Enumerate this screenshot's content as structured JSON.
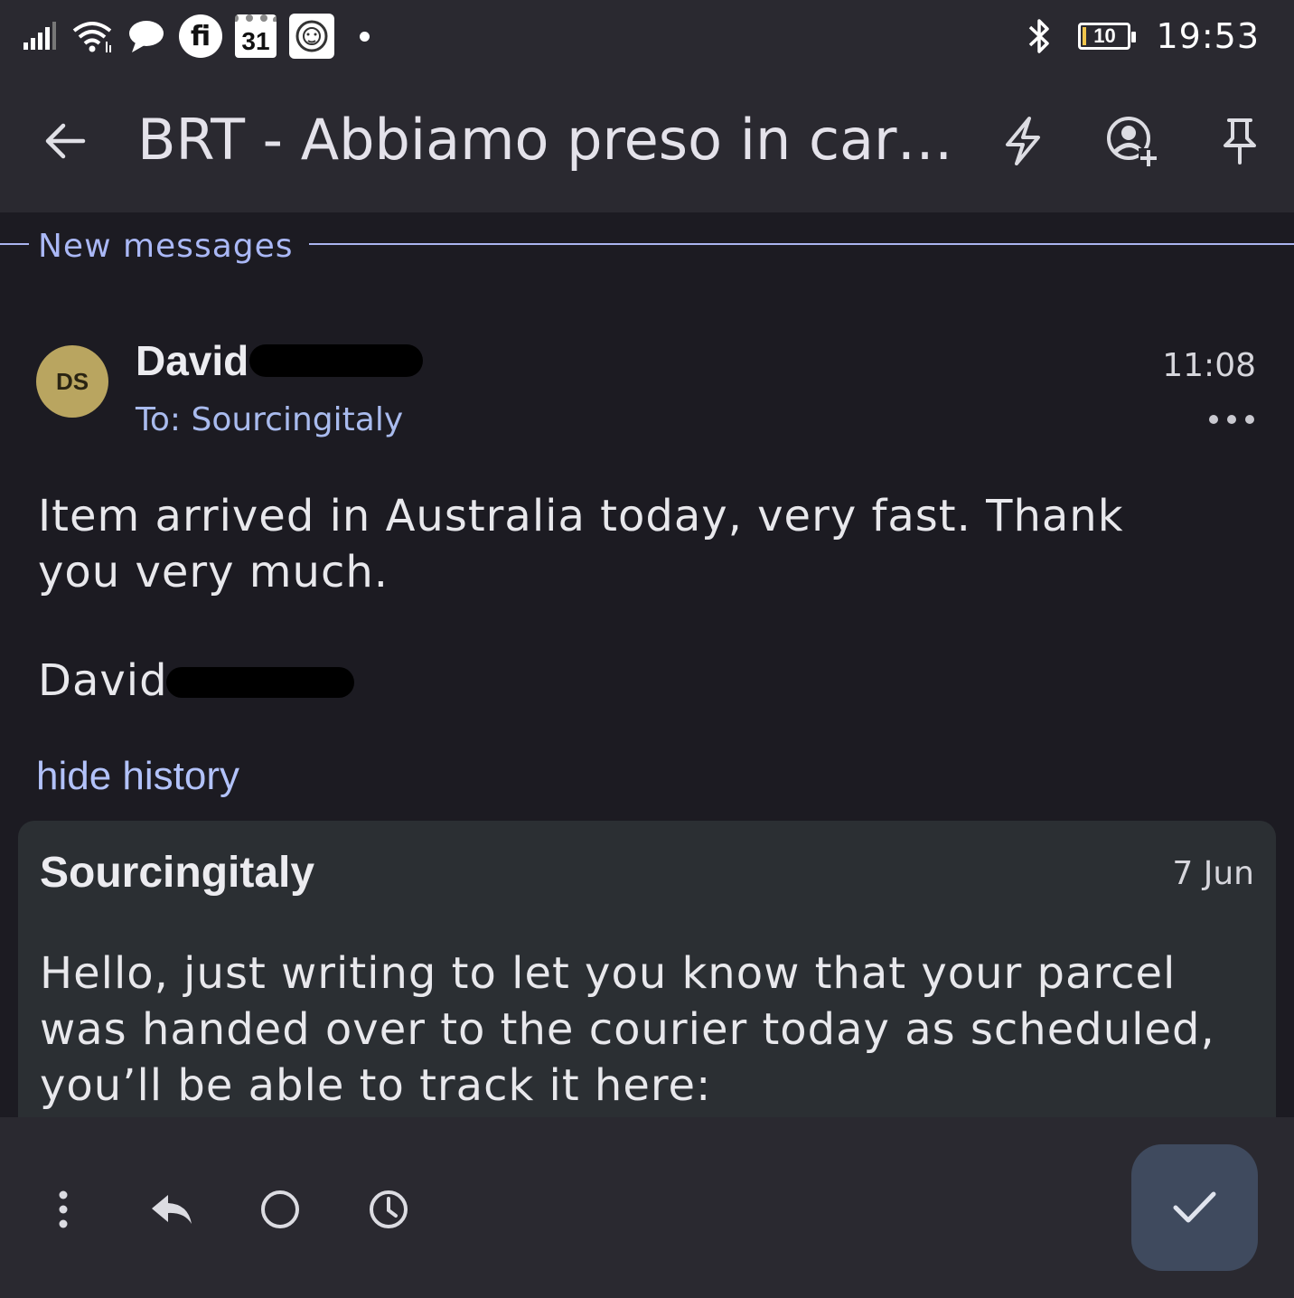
{
  "status_bar": {
    "icons_left": [
      "signal-icon",
      "wifi-icon",
      "chat-bubble-icon",
      "fi-app-icon",
      "calendar-icon",
      "lion-app-icon",
      "notification-dot"
    ],
    "fi_label": "fi",
    "calendar_day": "31",
    "battery": "10",
    "clock": "19:53"
  },
  "app_bar": {
    "title": "BRT - Abbiamo preso in car…",
    "actions": [
      "lightning-icon",
      "add-contact-icon",
      "pin-icon"
    ]
  },
  "divider": {
    "label": "New messages"
  },
  "message": {
    "avatar_initials": "DS",
    "sender": "David",
    "to": "To: Sourcingitaly",
    "time": "11:08",
    "body_lines": [
      "Item arrived in Australia today, very fast.  Thank",
      "you very much."
    ],
    "signature": "David"
  },
  "hide_history_label": "hide history",
  "history": {
    "sender": "Sourcingitaly",
    "date": "7 Jun",
    "body_lines": [
      "Hello, just writing to let you know that your parcel",
      "was handed over to the courier today as scheduled,",
      "you’ll be able to track it here:"
    ]
  },
  "bottom_bar": {
    "buttons": [
      "more-vert-icon",
      "reply-icon",
      "circle-icon",
      "snooze-clock-icon"
    ],
    "fab": "check-icon"
  },
  "colors": {
    "background": "#1c1b22",
    "bar": "#2a2930",
    "accent_blue": "#aab8f6",
    "avatar": "#b9a560",
    "card": "#2b2f33",
    "fab": "#3f4a5e"
  }
}
